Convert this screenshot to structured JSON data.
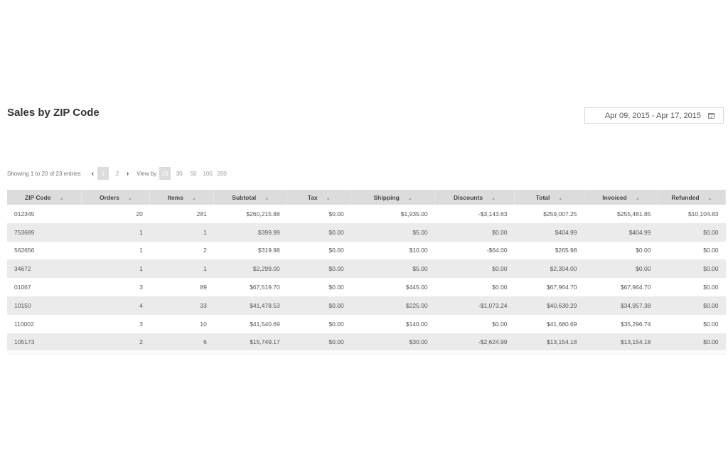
{
  "page": {
    "title": "Sales by ZIP Code",
    "date_range": "Apr 09, 2015 - Apr 17, 2015",
    "calendar_icon": "calendar-icon"
  },
  "pager": {
    "showing": "Showing 1 to 20 of 23 entries",
    "prev": "‹",
    "next": "›",
    "pages": [
      "1",
      "2"
    ],
    "current_page": "1",
    "view_by_label": "View by",
    "per_page": [
      "20",
      "30",
      "50",
      "100",
      "200"
    ],
    "current_per_page": "20"
  },
  "table": {
    "columns": [
      "ZIP Code",
      "Orders",
      "Items",
      "Subtotal",
      "Tax",
      "Shipping",
      "Discounts",
      "Total",
      "Invoiced",
      "Refunded"
    ],
    "sort_glyph": "▲",
    "rows": [
      [
        "012345",
        "20",
        "281",
        "$260,215.88",
        "$0.00",
        "$1,935.00",
        "-$3,143.63",
        "$259,007.25",
        "$255,481.85",
        "$10,104.83"
      ],
      [
        "753689",
        "1",
        "1",
        "$399.99",
        "$0.00",
        "$5.00",
        "$0.00",
        "$404.99",
        "$404.99",
        "$0.00"
      ],
      [
        "562656",
        "1",
        "2",
        "$319.98",
        "$0.00",
        "$10.00",
        "-$64.00",
        "$265.98",
        "$0.00",
        "$0.00"
      ],
      [
        "34672",
        "1",
        "1",
        "$2,299.00",
        "$0.00",
        "$5.00",
        "$0.00",
        "$2,304.00",
        "$0.00",
        "$0.00"
      ],
      [
        "01067",
        "3",
        "89",
        "$67,519.70",
        "$0.00",
        "$445.00",
        "$0.00",
        "$67,964.70",
        "$67,964.70",
        "$0.00"
      ],
      [
        "10150",
        "4",
        "33",
        "$41,478.53",
        "$0.00",
        "$225.00",
        "-$1,073.24",
        "$40,630.29",
        "$34,957.38",
        "$0.00"
      ],
      [
        "110002",
        "3",
        "10",
        "$41,540.69",
        "$0.00",
        "$140.00",
        "$0.00",
        "$41,680.69",
        "$35,296.74",
        "$0.00"
      ],
      [
        "105173",
        "2",
        "6",
        "$15,749.17",
        "$0.00",
        "$30.00",
        "-$2,624.99",
        "$13,154.18",
        "$13,154.18",
        "$0.00"
      ]
    ]
  }
}
